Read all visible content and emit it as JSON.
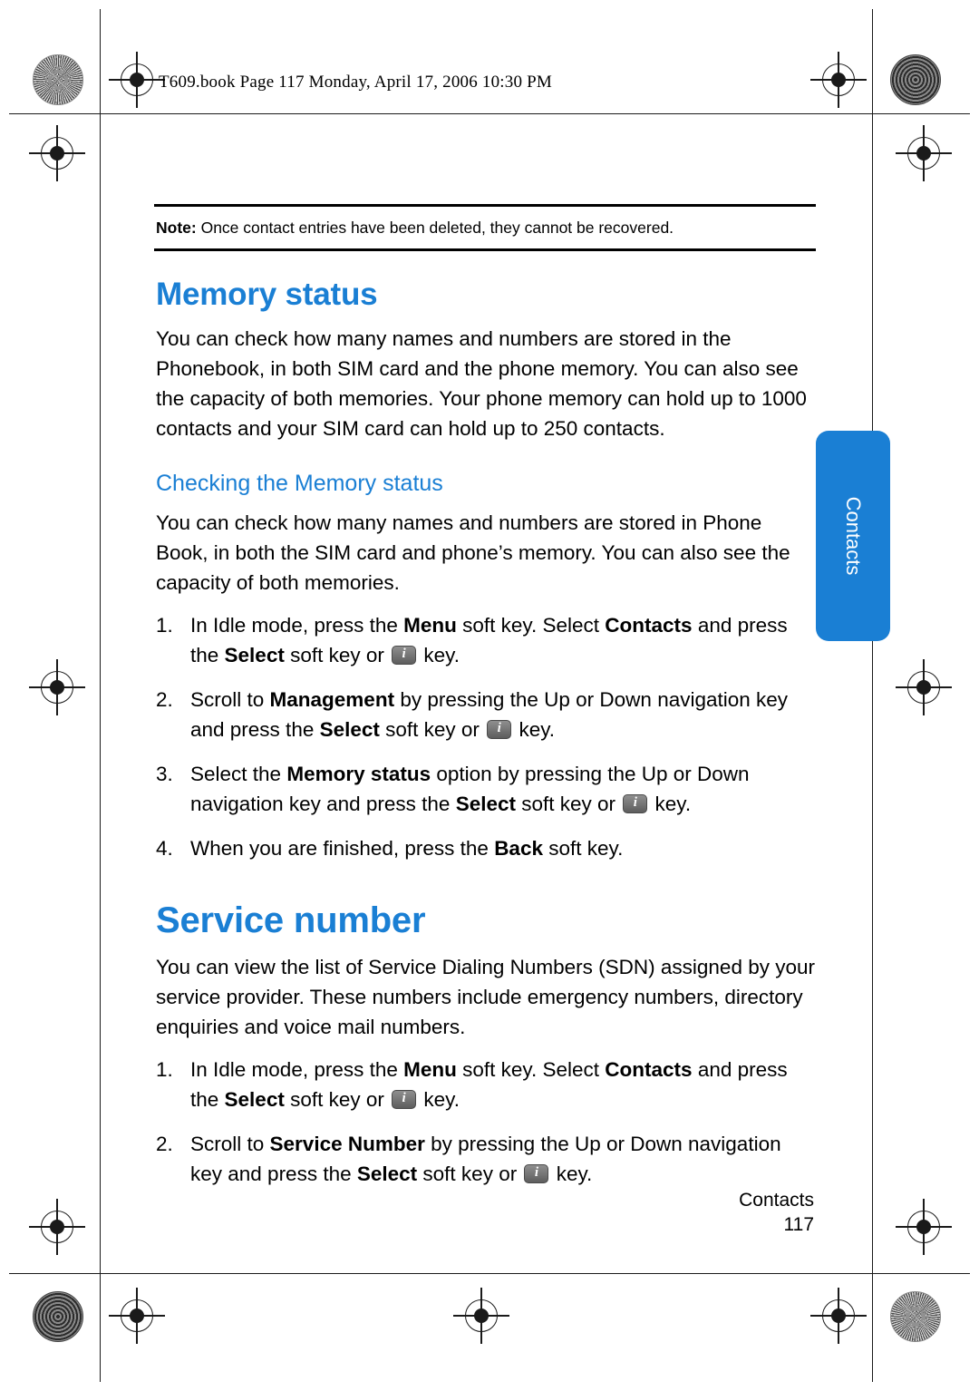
{
  "header": {
    "text": "T609.book  Page 117  Monday, April 17, 2006  10:30 PM"
  },
  "note": {
    "label": "Note:",
    "text": " Once contact entries have been deleted, they cannot be recovered."
  },
  "sections": [
    {
      "title": "Memory status",
      "paragraph": "You can check how many names and numbers are stored in the Phonebook, in both SIM card and the phone memory. You can also see the capacity of both memories. Your phone memory can hold up to 1000 contacts and your SIM card can hold up to 250 contacts.",
      "subtitle": "Checking the Memory status",
      "sub_paragraph": "You can check how many names and numbers are stored in Phone Book, in both the SIM card and phone’s memory. You can also see the capacity of both memories."
    },
    {
      "title": "Service number",
      "paragraph": "You can view the list of Service Dialing Numbers (SDN) assigned by your service provider. These numbers include emergency numbers, directory enquiries and voice mail numbers."
    }
  ],
  "steps_memory": [
    {
      "num": "1.",
      "parts": [
        {
          "t": "In Idle mode, press the ",
          "b": false
        },
        {
          "t": "Menu",
          "b": true
        },
        {
          "t": " soft key. Select ",
          "b": false
        },
        {
          "t": "Contacts",
          "b": true
        },
        {
          "t": " and press the ",
          "b": false
        },
        {
          "t": "Select",
          "b": true
        },
        {
          "t": " soft key or ",
          "b": false
        },
        {
          "t": "__KEY__",
          "b": false
        },
        {
          "t": " key.",
          "b": false
        }
      ]
    },
    {
      "num": "2.",
      "parts": [
        {
          "t": "Scroll to ",
          "b": false
        },
        {
          "t": "Management",
          "b": true
        },
        {
          "t": " by pressing the Up or Down navigation key and press the ",
          "b": false
        },
        {
          "t": "Select",
          "b": true
        },
        {
          "t": " soft key or ",
          "b": false
        },
        {
          "t": "__KEY__",
          "b": false
        },
        {
          "t": " key.",
          "b": false
        }
      ]
    },
    {
      "num": "3.",
      "parts": [
        {
          "t": "Select the ",
          "b": false
        },
        {
          "t": "Memory status",
          "b": true
        },
        {
          "t": " option by pressing the Up or Down navigation key and press the ",
          "b": false
        },
        {
          "t": "Select",
          "b": true
        },
        {
          "t": " soft key or ",
          "b": false
        },
        {
          "t": "__KEY__",
          "b": false
        },
        {
          "t": " key.",
          "b": false
        }
      ]
    },
    {
      "num": "4.",
      "parts": [
        {
          "t": "When you are finished, press the ",
          "b": false
        },
        {
          "t": "Back",
          "b": true
        },
        {
          "t": " soft key.",
          "b": false
        }
      ]
    }
  ],
  "steps_service": [
    {
      "num": "1.",
      "parts": [
        {
          "t": "In Idle mode, press the ",
          "b": false
        },
        {
          "t": "Menu",
          "b": true
        },
        {
          "t": " soft key. Select ",
          "b": false
        },
        {
          "t": "Contacts",
          "b": true
        },
        {
          "t": " and press the ",
          "b": false
        },
        {
          "t": "Select",
          "b": true
        },
        {
          "t": " soft key or ",
          "b": false
        },
        {
          "t": "__KEY__",
          "b": false
        },
        {
          "t": " key.",
          "b": false
        }
      ]
    },
    {
      "num": "2.",
      "parts": [
        {
          "t": "Scroll to ",
          "b": false
        },
        {
          "t": "Service Number",
          "b": true
        },
        {
          "t": " by pressing the Up or Down navigation key and press the ",
          "b": false
        },
        {
          "t": "Select",
          "b": true
        },
        {
          "t": " soft key or ",
          "b": false
        },
        {
          "t": "__KEY__",
          "b": false
        },
        {
          "t": " key.",
          "b": false
        }
      ]
    }
  ],
  "side_tab": {
    "label": "Contacts"
  },
  "footer": {
    "chapter": "Contacts",
    "page": "117"
  },
  "colors": {
    "accent": "#1a7fd4",
    "text": "#000000"
  }
}
